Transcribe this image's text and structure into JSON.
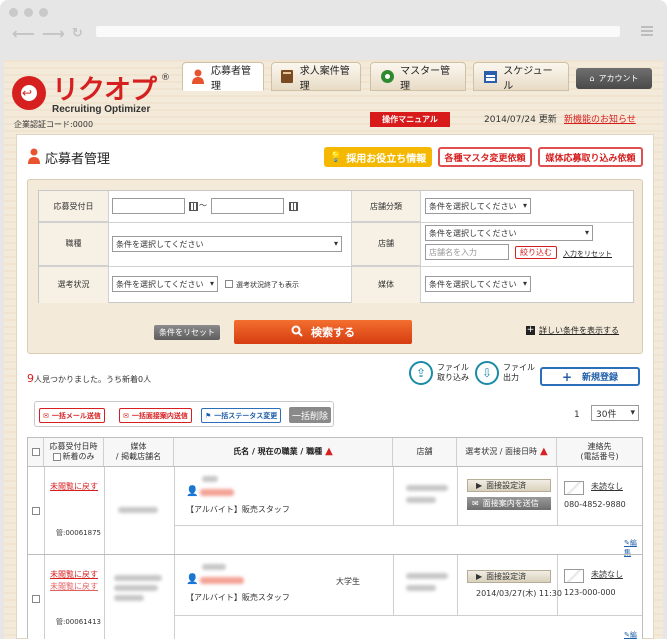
{
  "header": {
    "logo_name": "リクオプ",
    "logo_mark": "®",
    "logo_sub": "Recruiting Optimizer",
    "tabs": [
      {
        "label": "応募者管理"
      },
      {
        "label": "求人案件管理"
      },
      {
        "label": "マスター管理"
      },
      {
        "label": "スケジュール"
      }
    ],
    "account_label": "アカウント",
    "company_code": "企業認証コード:0000",
    "manual_label": "操作マニュアル",
    "update_date": "2014/07/24 更新",
    "update_link": "新機能のお知らせ"
  },
  "panel": {
    "title": "応募者管理",
    "help_label": "採用お役立ち情報",
    "master_change_label": "各種マスタ変更依頼",
    "media_import_label": "媒体応募取り込み依頼"
  },
  "search": {
    "date_label": "応募受付日",
    "date_sep": "〜",
    "store_category_label": "店舗分類",
    "store_category_value": "条件を選択してください",
    "job_label": "職種",
    "job_value": "条件を選択してください",
    "store_label": "店舗",
    "store_value": "条件を選択してください",
    "store_name_placeholder": "店舗名を入力",
    "narrow_label": "絞り込む",
    "input_list_label": "入力をリセット",
    "status_label": "選考状況",
    "status_value": "条件を選択してください",
    "status_finished_label": "選考状況終了も表示",
    "media_label": "媒体",
    "media_value": "条件を選択してください",
    "reset_label": "条件をリセット",
    "search_label": "検索する",
    "detail_label": "詳しい条件を表示する"
  },
  "results": {
    "count_number": "9",
    "count_text": "人見つかりました。うち新着0人",
    "file_import_label": "ファイル\n取り込み",
    "file_export_label": "ファイル\n出力",
    "new_label": "新規登録",
    "bulk_mail_label": "一括メール送信",
    "bulk_interview_label": "一括面接案内送信",
    "bulk_status_label": "一括ステータス変更",
    "bulk_delete_label": "一括削除",
    "page_number": "1",
    "per_page": "30件"
  },
  "grid": {
    "headers": {
      "date": "応募受付日時",
      "new_only": "新着のみ",
      "media": "媒体",
      "media_sub": "/ 掲載店舗名",
      "name": "氏名 / 現在の職業 / 職種",
      "store": "店舗",
      "status": "選考状況 / 面接日時",
      "contact": "連絡先",
      "contact_sub": "(電話番号)"
    },
    "rows": [
      {
        "back_label": "未閲覧に戻す",
        "id": "管:00061875",
        "job": "【アルバイト】販売スタッフ",
        "occupation": "",
        "status_btn": "面接設定済",
        "status_btn2": "面接案内を送信",
        "interview_date": "",
        "unread": "未読なし",
        "phone": "080-4852-9880",
        "edit": "編集"
      },
      {
        "back_label": "未閲覧に戻す",
        "id": "管:00061413",
        "job": "【アルバイト】販売スタッフ",
        "occupation": "大学生",
        "status_btn": "面接設定済",
        "status_btn2": "",
        "interview_date": "2014/03/27(木) 11:30",
        "unread": "未読なし",
        "phone": "123-000-000",
        "edit": "編集"
      }
    ]
  }
}
